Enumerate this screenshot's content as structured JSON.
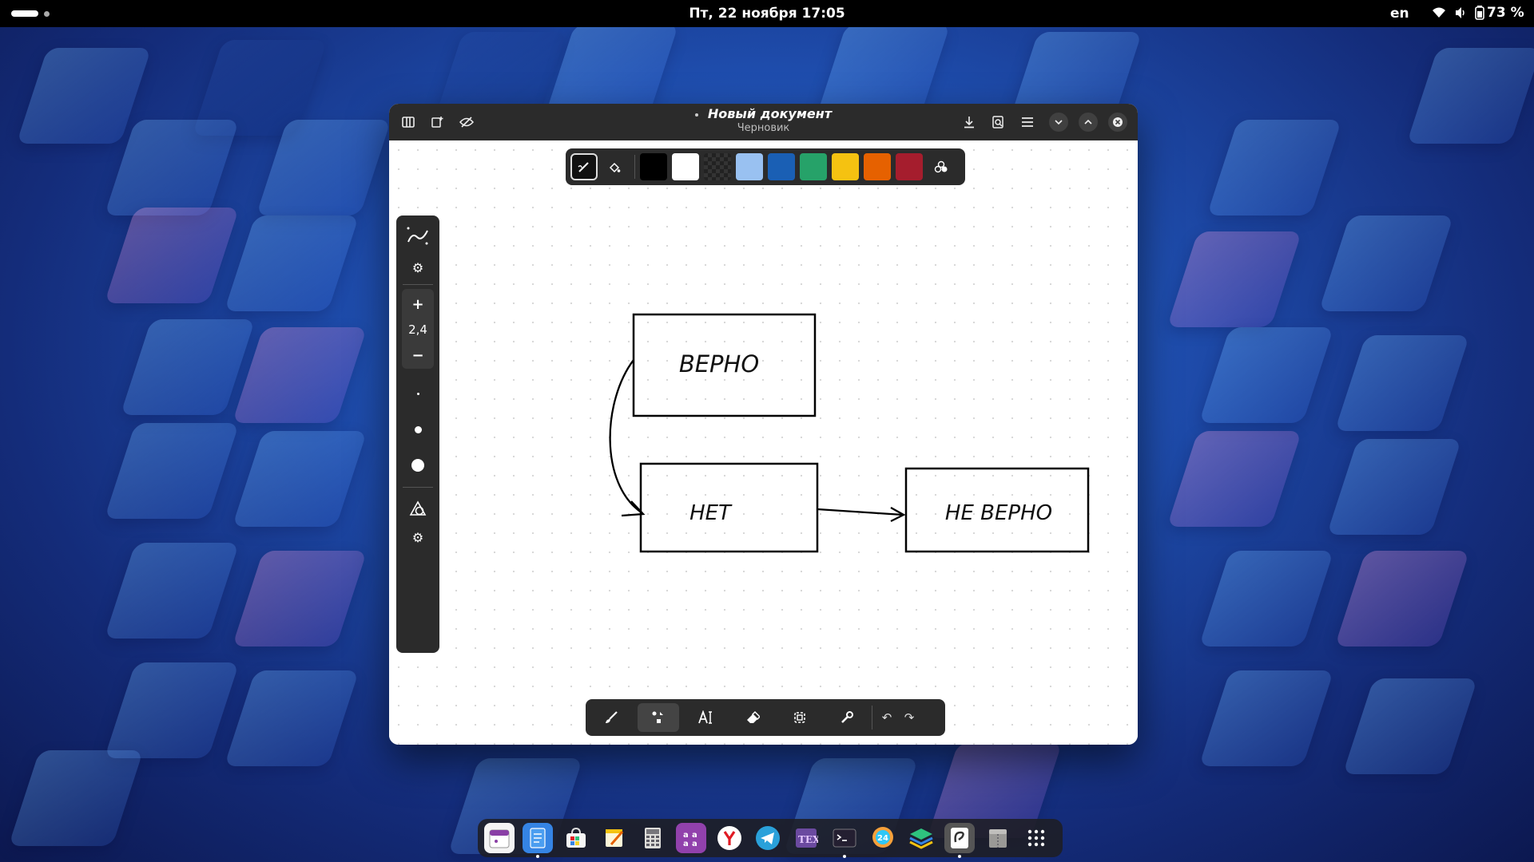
{
  "topbar": {
    "clock": "Пт, 22 ноября  17:05",
    "lang": "en",
    "battery": "73 %",
    "icons": [
      "wifi-icon",
      "volume-icon",
      "battery-icon"
    ]
  },
  "window": {
    "title": "Новый документ",
    "subtitle": "Черновик",
    "header_left_icons": [
      "sidebar-icon",
      "new-document-icon",
      "hide-ui-icon"
    ],
    "header_right_icons": [
      "save-icon",
      "export-icon",
      "menu-icon"
    ]
  },
  "color_toolbar": {
    "tools": [
      "pen-style-icon",
      "fill-icon"
    ],
    "colors": [
      "#000000",
      "#ffffff",
      "transparent",
      "#99c1f1",
      "#1a5fb4",
      "#26a269",
      "#f5c211",
      "#e66100",
      "#a51d2d"
    ],
    "extra": "color-picker-icon"
  },
  "left_panel": {
    "zoom_plus": "+",
    "size_value": "2,4",
    "zoom_minus": "−"
  },
  "diagram": {
    "box_true": "ВЕРНО",
    "box_no": "НЕТ",
    "box_false": "НЕ ВЕРНО"
  },
  "bottom_toolbar": {
    "tools": [
      "brush-icon",
      "shapes-icon",
      "text-icon",
      "eraser-icon",
      "selector-icon",
      "tools-icon"
    ],
    "active": "shapes-icon",
    "undo": "↶",
    "redo": "↷"
  },
  "dock": {
    "apps": [
      "calendar",
      "text-editor",
      "software-store",
      "notes",
      "calculator",
      "fonts",
      "yandex-browser",
      "telegram",
      "tex-editor",
      "terminal",
      "bitrix24",
      "layers",
      "rnote",
      "archive",
      "app-grid"
    ]
  }
}
